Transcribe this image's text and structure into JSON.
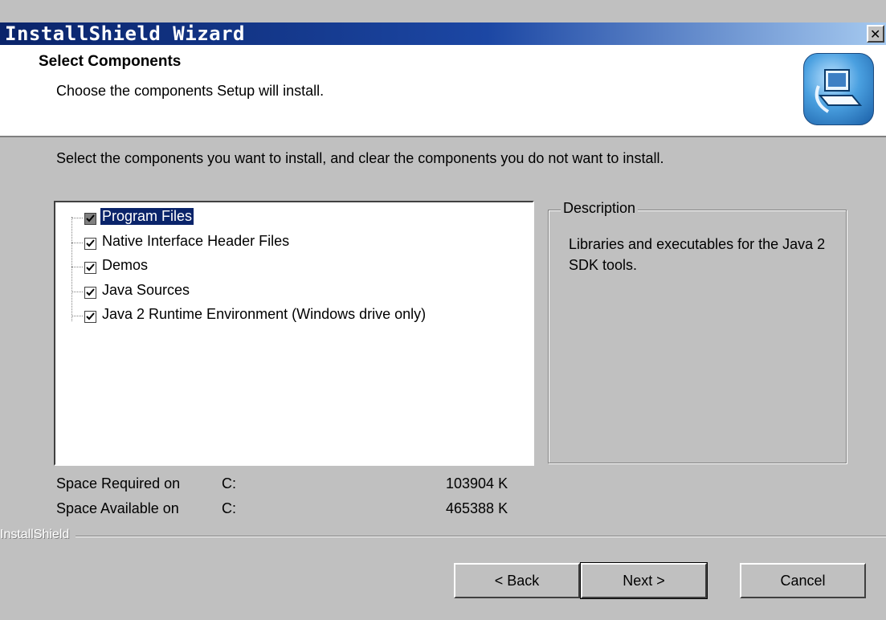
{
  "window": {
    "title": "InstallShield Wizard",
    "close_glyph": "✕"
  },
  "header": {
    "title": "Select Components",
    "subtitle": "Choose the components Setup will install.",
    "icon": "setup-computer-icon"
  },
  "instruction": "Select the components you want to install, and clear the components you do not want to install.",
  "components": [
    {
      "label": "Program Files",
      "checked": true,
      "selected": true,
      "grayed": true
    },
    {
      "label": "Native Interface Header Files",
      "checked": true,
      "selected": false,
      "grayed": false
    },
    {
      "label": "Demos",
      "checked": true,
      "selected": false,
      "grayed": false
    },
    {
      "label": "Java Sources",
      "checked": true,
      "selected": false,
      "grayed": false
    },
    {
      "label": "Java 2 Runtime Environment (Windows drive only)",
      "checked": true,
      "selected": false,
      "grayed": false
    }
  ],
  "description": {
    "legend": "Description",
    "text": "Libraries and executables for the Java 2 SDK tools."
  },
  "space": {
    "required_label": "Space Required on",
    "required_drive": "C:",
    "required_value": "103904 K",
    "available_label": "Space Available on",
    "available_drive": "C:",
    "available_value": "465388 K"
  },
  "brand": "InstallShield",
  "buttons": {
    "back": "< Back",
    "next": "Next >",
    "cancel": "Cancel"
  }
}
